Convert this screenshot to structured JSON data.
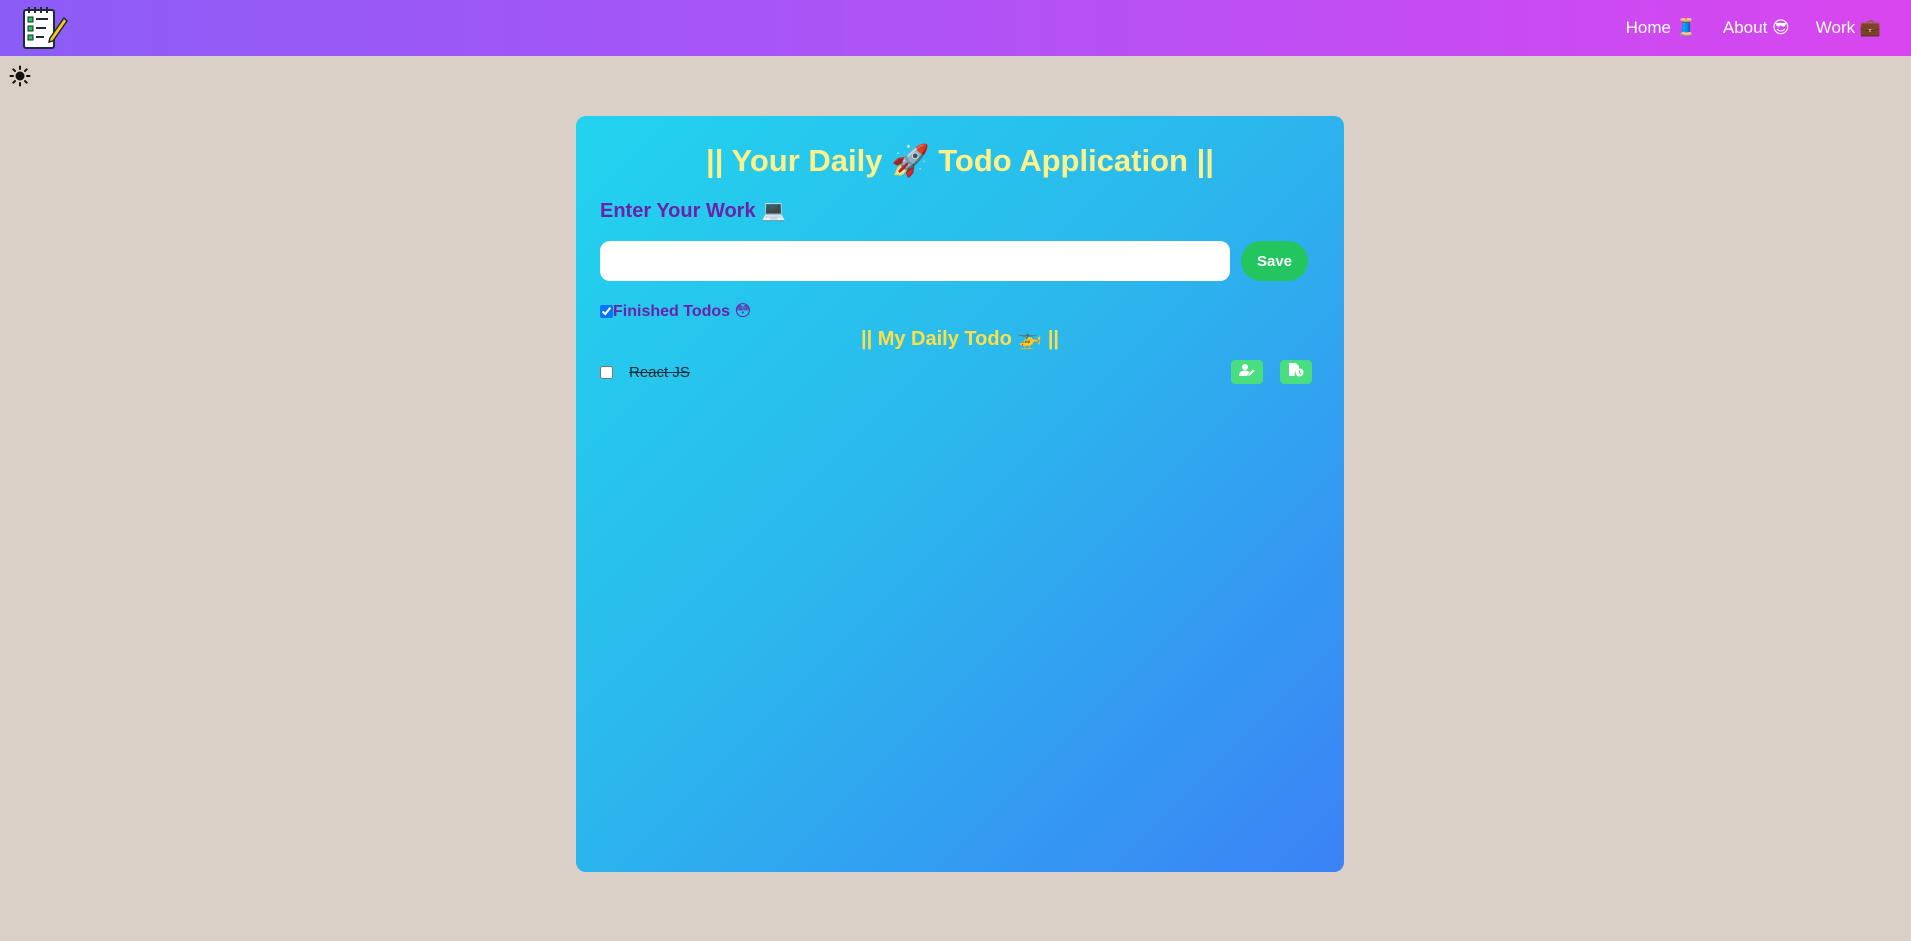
{
  "navbar": {
    "logo_icon": "notepad-checklist-icon",
    "links": [
      {
        "label": "Home 🧵"
      },
      {
        "label": "About 😎"
      },
      {
        "label": "Work 💼"
      }
    ]
  },
  "theme_toggle": {
    "icon": "sun-icon"
  },
  "card": {
    "title": "|| Your Daily 🚀 Todo Application ||",
    "work_label": "Enter Your Work 💻",
    "input": {
      "value": "",
      "placeholder": ""
    },
    "save_label": "Save",
    "finished": {
      "label": "Finished Todos 😳",
      "checked": true
    },
    "list_title": "|| My Daily Todo 🚁 ||",
    "todos": [
      {
        "text": "React JS",
        "checked": false,
        "completed": true,
        "edit_icon": "user-edit-icon",
        "delete_icon": "file-clock-icon"
      }
    ]
  },
  "colors": {
    "navbar_gradient": [
      "#8b5cf6",
      "#d946ef"
    ],
    "card_gradient": [
      "#22d3ee",
      "#3b82f6"
    ],
    "title": "#fef08a",
    "label": "#6b21a8",
    "save_button": "#22c55e",
    "icon_button": "#4ade80",
    "background": "#dbd0c8"
  }
}
